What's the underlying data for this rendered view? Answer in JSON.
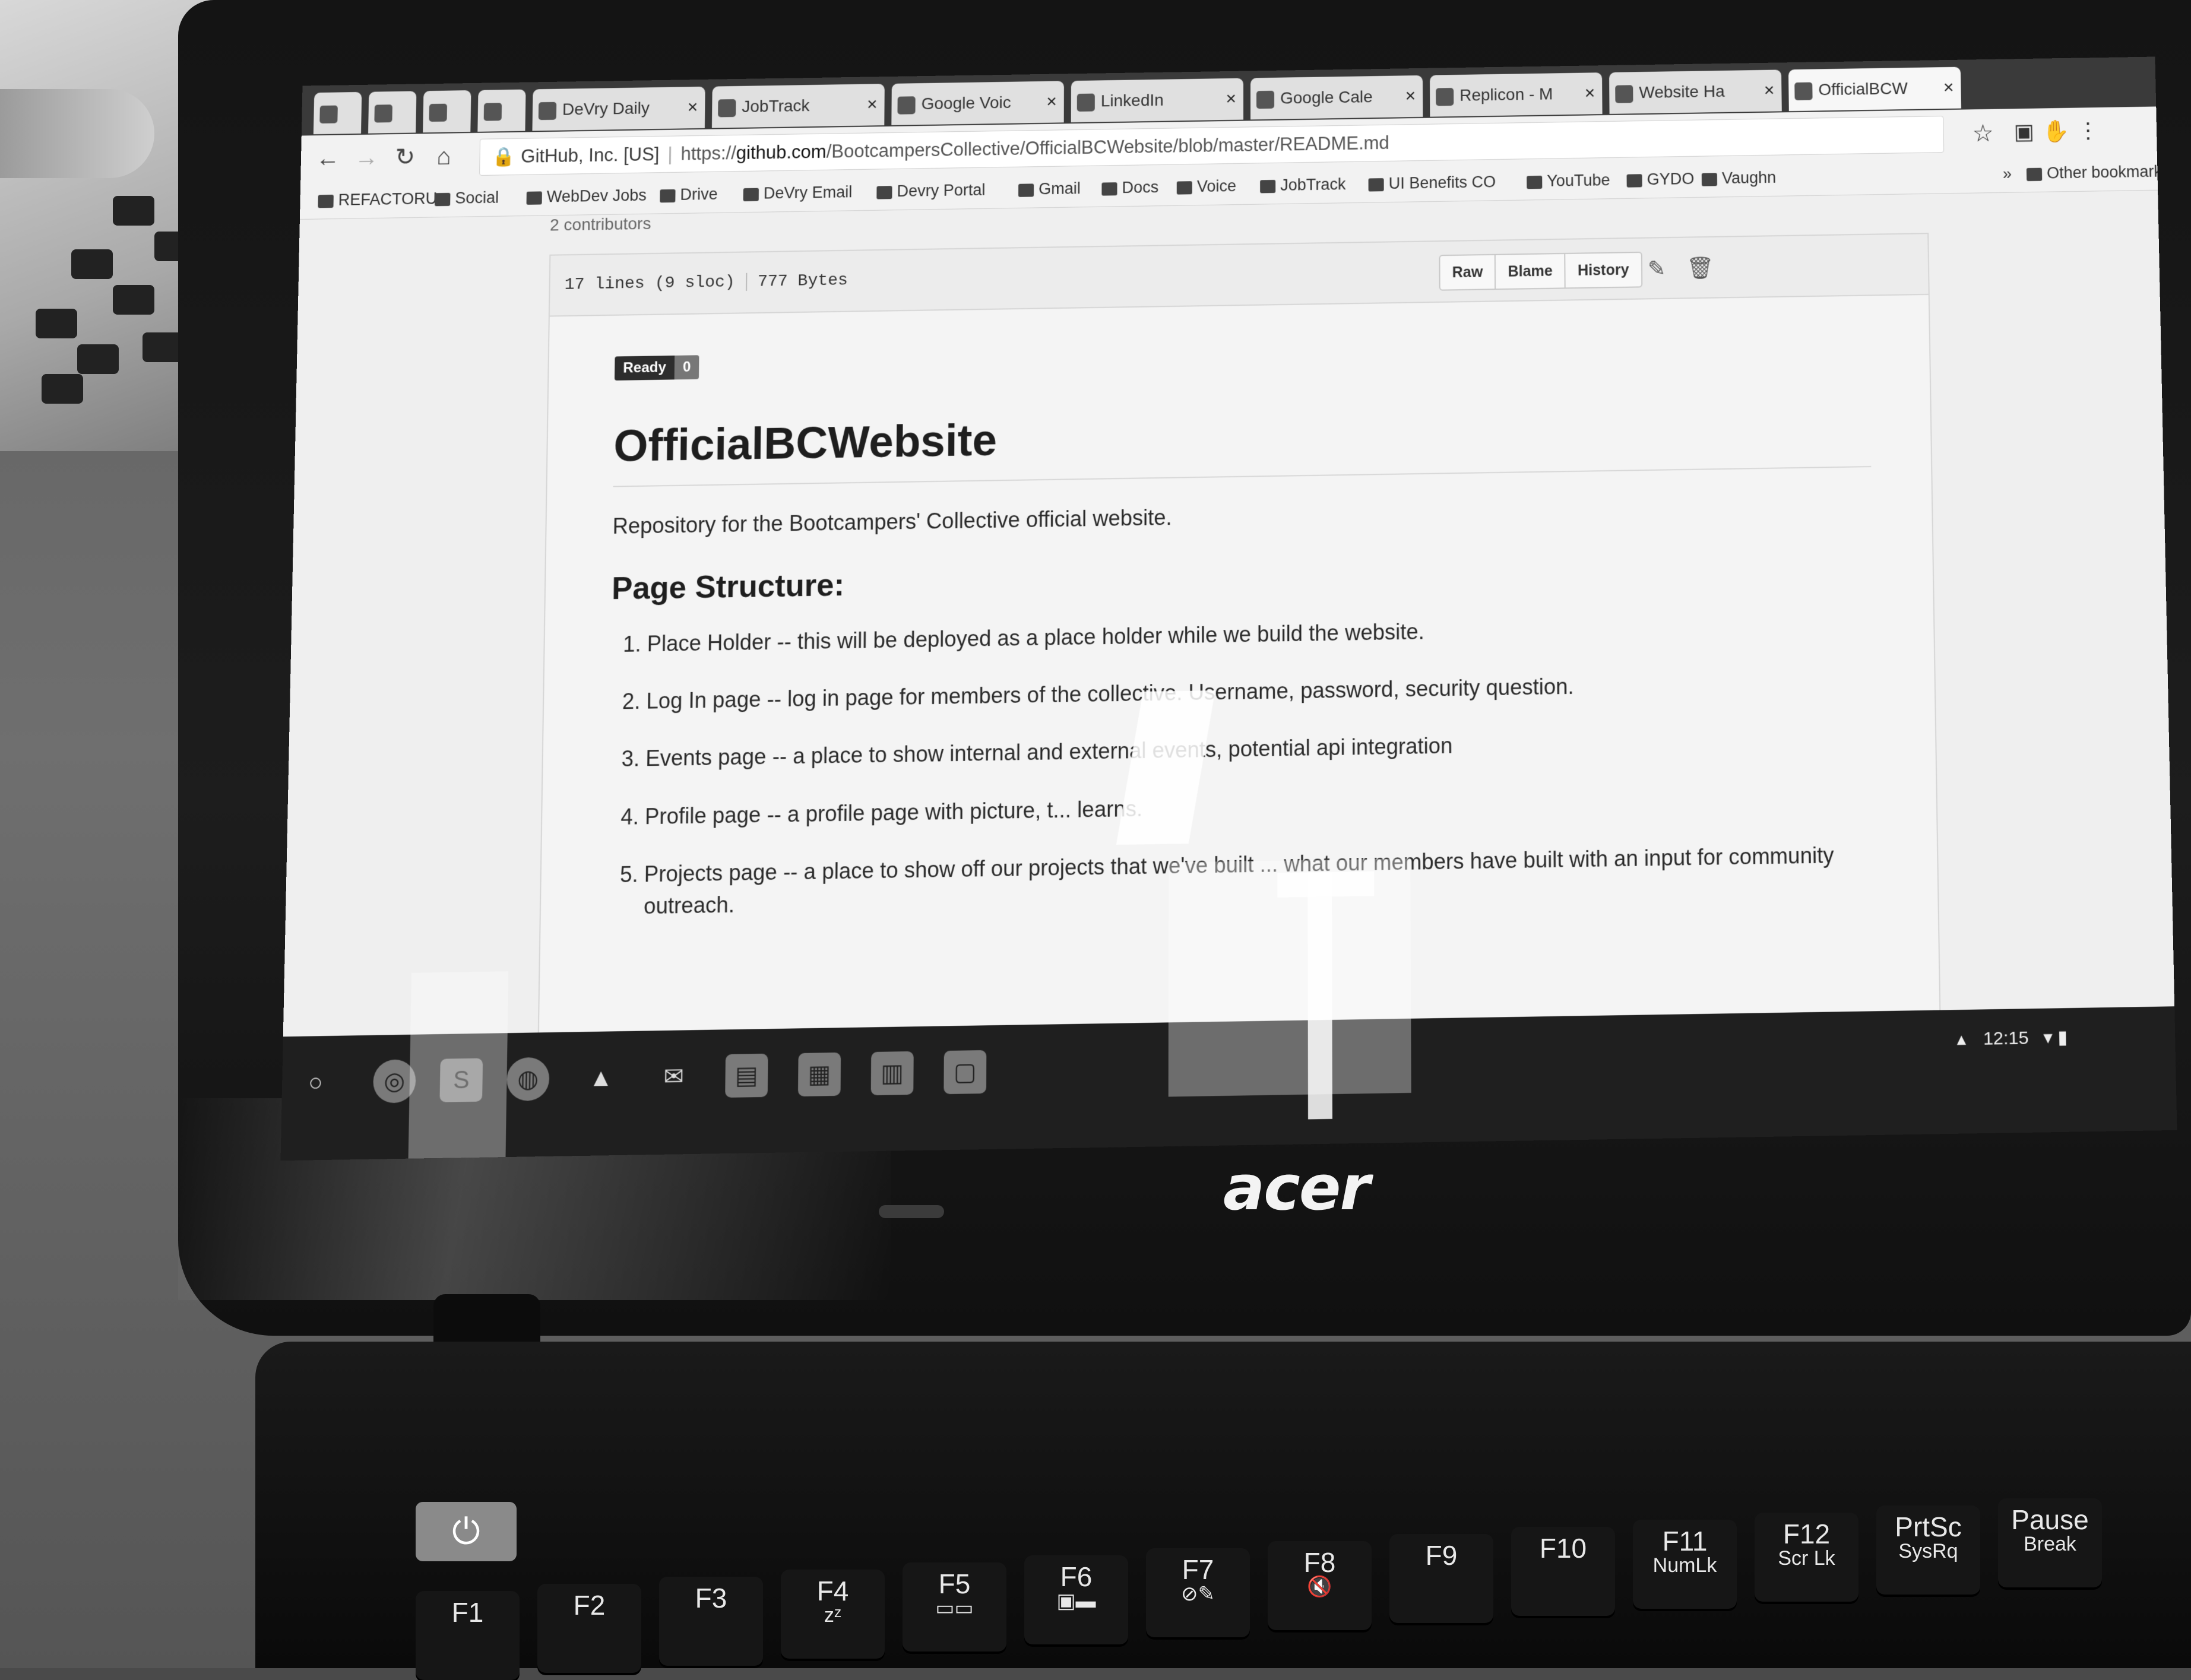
{
  "tabs": [
    {
      "label": "",
      "pinned": true
    },
    {
      "label": "",
      "pinned": true
    },
    {
      "label": "",
      "pinned": true
    },
    {
      "label": "",
      "pinned": true
    },
    {
      "label": "DeVry Daily",
      "pinned": false
    },
    {
      "label": "JobTrack",
      "pinned": false
    },
    {
      "label": "Google Voic",
      "pinned": false
    },
    {
      "label": "LinkedIn",
      "pinned": false
    },
    {
      "label": "Google Cale",
      "pinned": false
    },
    {
      "label": "Replicon - M",
      "pinned": false
    },
    {
      "label": "Website Ha",
      "pinned": false
    },
    {
      "label": "OfficialBCW",
      "pinned": false,
      "active": true
    }
  ],
  "omnibox": {
    "secure_label": "GitHub, Inc. [US]",
    "url_scheme": "https://",
    "url_host": "github.com",
    "url_path": "/BootcampersCollective/OfficialBCWebsite/blob/master/README.md"
  },
  "bookmarks": [
    "REFACTORU",
    "Social",
    "WebDev Jobs",
    "Drive",
    "DeVry Email",
    "Devry Portal",
    "Gmail",
    "Docs",
    "Voice",
    "JobTrack",
    "UI Benefits CO",
    "YouTube",
    "GYDO",
    "Vaughn"
  ],
  "bookmarks_overflow": "»",
  "other_bookmarks": "Other bookmarks",
  "contributors_text": "2 contributors",
  "file": {
    "lines": "17 lines (9 sloc)",
    "size": "777 Bytes",
    "buttons": {
      "raw": "Raw",
      "blame": "Blame",
      "history": "History"
    }
  },
  "readme": {
    "badge_label": "Ready",
    "badge_count": "0",
    "title": "OfficialBCWebsite",
    "description": "Repository for the Bootcampers' Collective official website.",
    "section_heading": "Page Structure:",
    "items": [
      "Place Holder -- this will be deployed as a place holder while we build the website.",
      "Log In page -- log in page for members of the collective. Username, password, security question.",
      "Events page -- a place to show internal and external events, potential api integration",
      "Profile page -- a profile page with picture, t... learns.",
      "Projects page -- a place to show off our projects that we've built ... what our members have built with an input for community outreach."
    ]
  },
  "tray": {
    "time": "12:15"
  },
  "laptop": {
    "brand": "acer",
    "keys": [
      {
        "main": "F1",
        "sub": ""
      },
      {
        "main": "F2",
        "sub": ""
      },
      {
        "main": "F3",
        "sub": ""
      },
      {
        "main": "F4",
        "sub": "zᶻ"
      },
      {
        "main": "F5",
        "sub": "▭▭"
      },
      {
        "main": "F6",
        "sub": "▣▬"
      },
      {
        "main": "F7",
        "sub": "⊘✎"
      },
      {
        "main": "F8",
        "sub": "🔇"
      },
      {
        "main": "F9",
        "sub": ""
      },
      {
        "main": "F10",
        "sub": ""
      },
      {
        "main": "F11",
        "sub": "NumLk"
      },
      {
        "main": "F12",
        "sub": "Scr Lk"
      },
      {
        "main": "PrtSc",
        "sub": "SysRq"
      },
      {
        "main": "Pause",
        "sub": "Break"
      }
    ]
  }
}
